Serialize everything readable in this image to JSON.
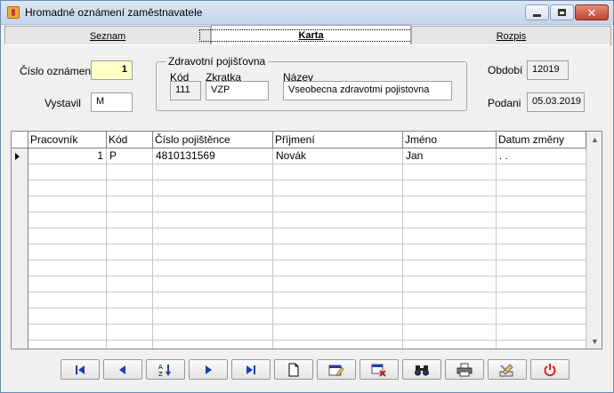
{
  "window": {
    "title": "Hromadné oznámení zaměstnavatele"
  },
  "tabs": [
    {
      "label": "Seznam",
      "active": false
    },
    {
      "label": "Karta",
      "active": true
    },
    {
      "label": "Rozpis",
      "active": false
    }
  ],
  "form": {
    "cislo_label": "Číslo oznámení",
    "cislo_value": "1",
    "vystavil_label": "Vystavil",
    "vystavil_value": "M",
    "group_title": "Zdravotní pojišťovna",
    "kod_label": "Kód",
    "kod_value": "111",
    "zkratka_label": "Zkratka",
    "zkratka_value": "VZP",
    "nazev_label": "Název",
    "nazev_value": "Vseobecna zdravotmi pojistovna",
    "obdobi_label": "Období",
    "obdobi_value": "12019",
    "podani_label": "Podani",
    "podani_value": "05.03.2019"
  },
  "grid": {
    "columns": [
      "Pracovník",
      "Kód",
      "Číslo pojištěnce",
      "Příjmení",
      "Jméno",
      "Datum změny"
    ],
    "rows": [
      [
        "1",
        "P",
        "4810131569",
        "Novák",
        "Jan",
        ". ."
      ]
    ],
    "empty_rows": 12
  },
  "toolbar": {
    "buttons": [
      {
        "name": "first-record-button",
        "icon": "first-icon"
      },
      {
        "name": "prev-record-button",
        "icon": "prev-icon"
      },
      {
        "name": "sort-button",
        "icon": "sort-az-icon"
      },
      {
        "name": "next-record-button",
        "icon": "next-icon"
      },
      {
        "name": "last-record-button",
        "icon": "last-icon"
      },
      {
        "name": "new-record-button",
        "icon": "new-document-icon"
      },
      {
        "name": "edit-record-button",
        "icon": "edit-icon"
      },
      {
        "name": "delete-record-button",
        "icon": "delete-icon"
      },
      {
        "name": "search-button",
        "icon": "binoculars-icon"
      },
      {
        "name": "print-button",
        "icon": "printer-icon"
      },
      {
        "name": "tools-button",
        "icon": "tools-icon"
      },
      {
        "name": "exit-button",
        "icon": "power-icon"
      }
    ]
  },
  "colors": {
    "accent_blue": "#1f3fa8",
    "delete_red": "#cc2020",
    "power_red": "#e02020",
    "cislo_field_bg": "#ffffc8"
  }
}
